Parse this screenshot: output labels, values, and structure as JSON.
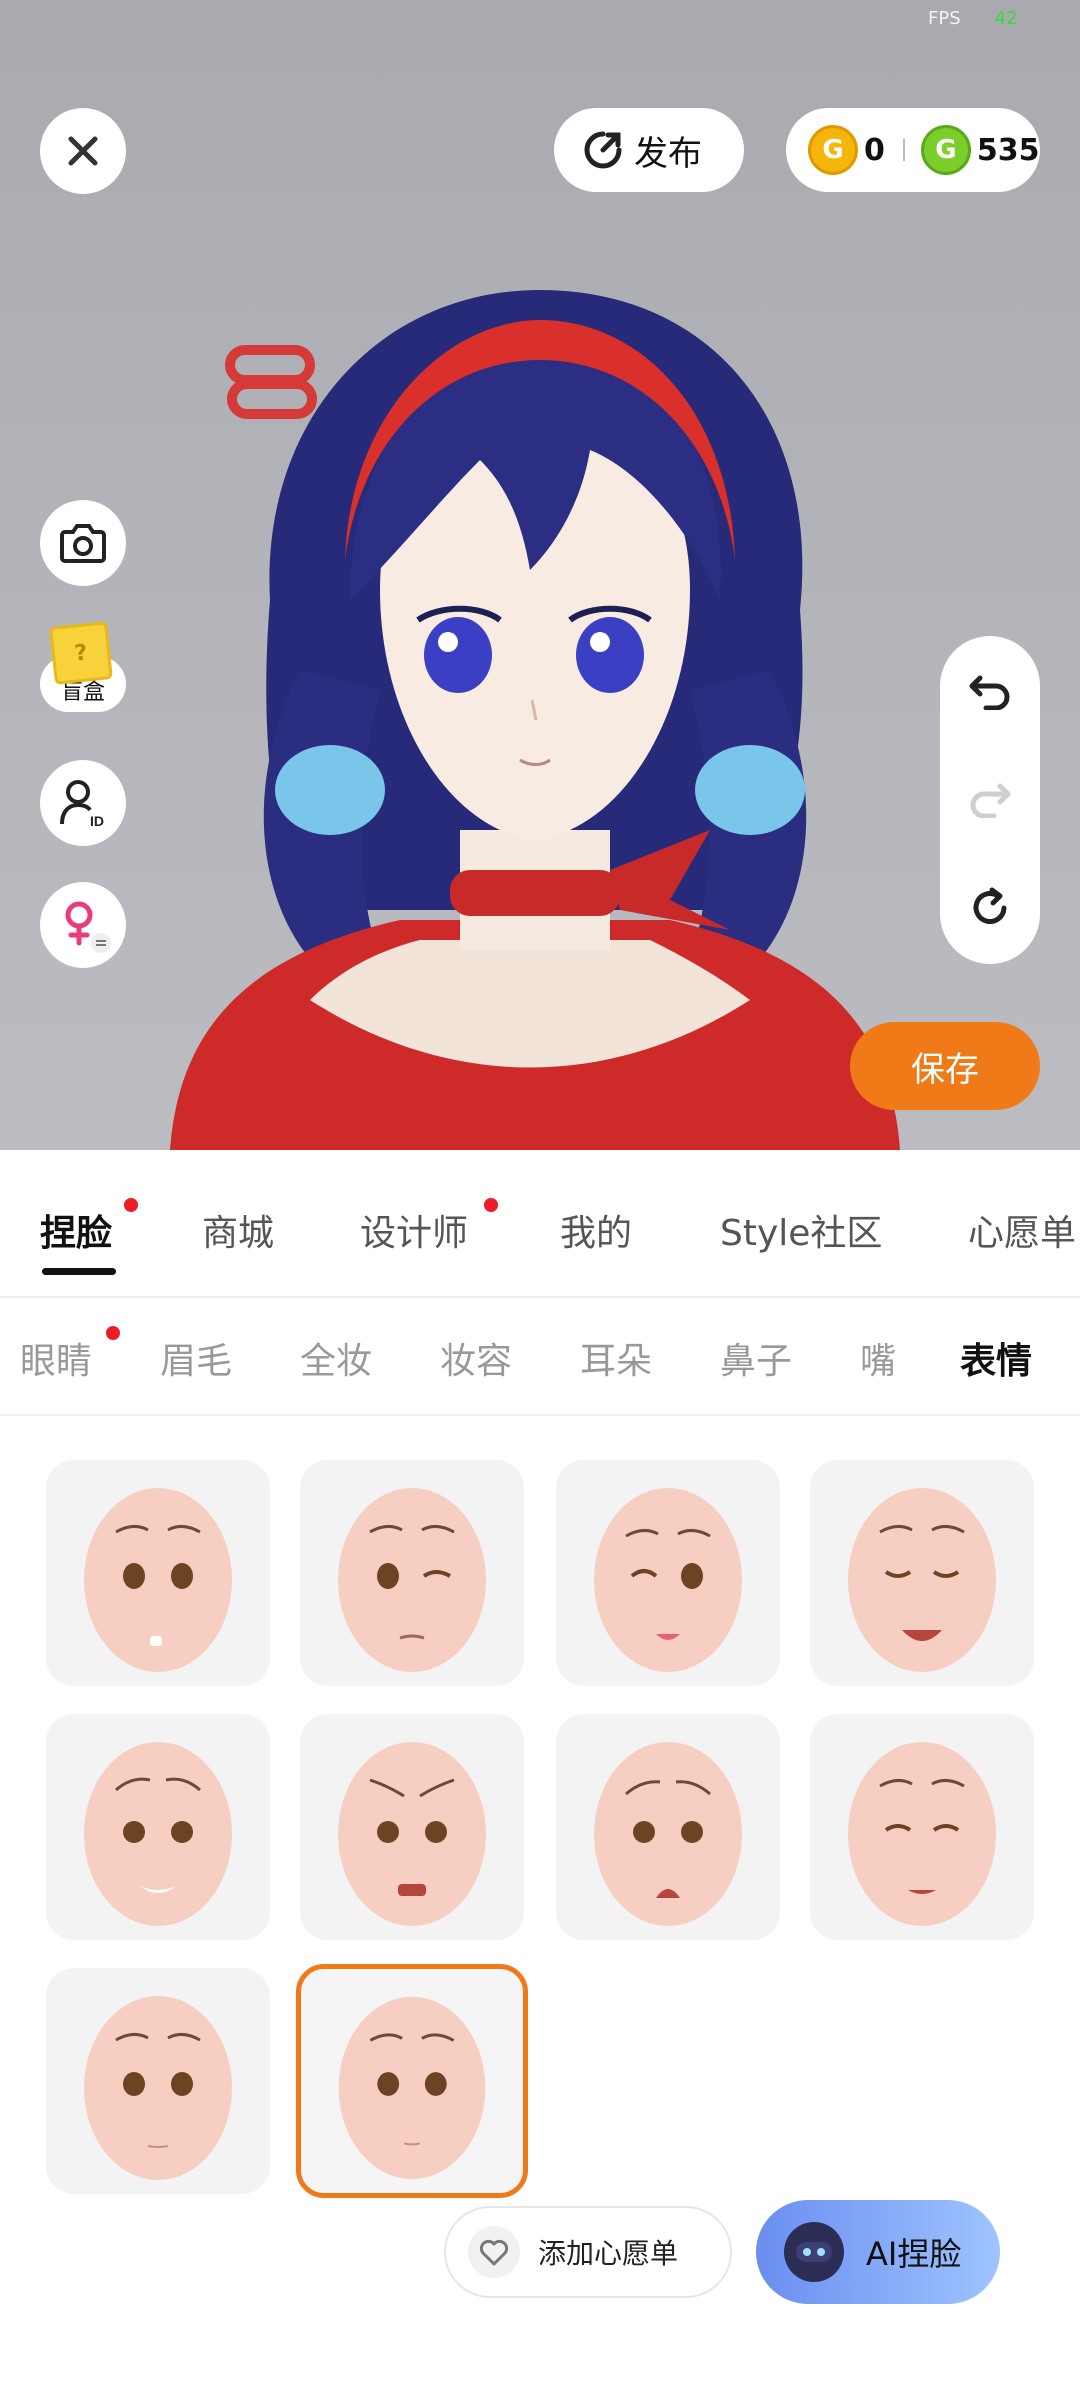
{
  "status": {
    "fps_label": "FPS",
    "fps_value": "42"
  },
  "top": {
    "publish_label": "发布",
    "gold_coin": "0",
    "green_coin": "535"
  },
  "side": {
    "blind_box_label": "盲盒"
  },
  "save_label": "保存",
  "main_tabs": [
    {
      "label": "捏脸",
      "active": true,
      "dot": true
    },
    {
      "label": "商城",
      "active": false,
      "dot": false
    },
    {
      "label": "设计师",
      "active": false,
      "dot": true
    },
    {
      "label": "我的",
      "active": false,
      "dot": false
    },
    {
      "label": "Style社区",
      "active": false,
      "dot": false
    },
    {
      "label": "心愿单",
      "active": false,
      "dot": false
    }
  ],
  "sub_tabs": [
    {
      "label": "眼睛",
      "active": false,
      "dot": true
    },
    {
      "label": "眉毛",
      "active": false
    },
    {
      "label": "全妆",
      "active": false
    },
    {
      "label": "妆容",
      "active": false
    },
    {
      "label": "耳朵",
      "active": false
    },
    {
      "label": "鼻子",
      "active": false
    },
    {
      "label": "嘴",
      "active": false
    },
    {
      "label": "表情",
      "active": true
    }
  ],
  "expressions": [
    {
      "id": "expression-neutral-teeth",
      "selected": false
    },
    {
      "id": "expression-wink",
      "selected": false
    },
    {
      "id": "expression-tongue-out",
      "selected": false
    },
    {
      "id": "expression-laugh",
      "selected": false
    },
    {
      "id": "expression-worried-smile",
      "selected": false
    },
    {
      "id": "expression-angry",
      "selected": false
    },
    {
      "id": "expression-sad",
      "selected": false
    },
    {
      "id": "expression-happy-closed-eyes",
      "selected": false
    },
    {
      "id": "expression-calm",
      "selected": false
    },
    {
      "id": "expression-default",
      "selected": true
    }
  ],
  "wishlist_label": "添加心愿单",
  "ai_label": "AI捏脸",
  "colors": {
    "accent": "#f07a18",
    "badge": "#ee1c25"
  }
}
